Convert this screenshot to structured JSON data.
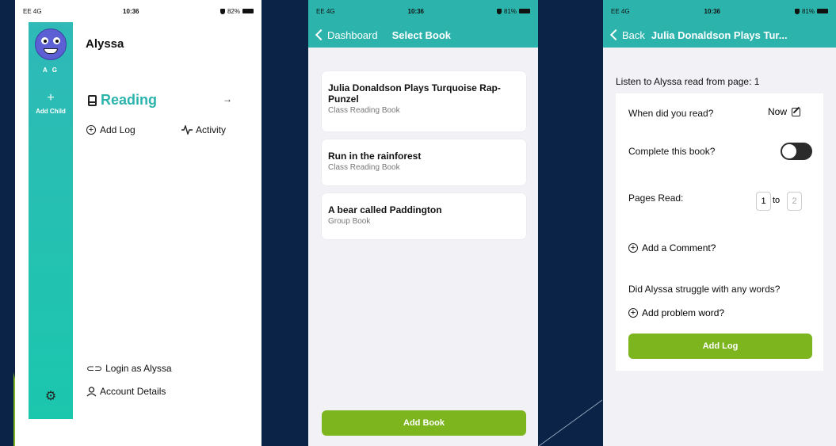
{
  "screen1": {
    "status": {
      "carrier": "EE 4G",
      "time": "10:36",
      "battery": "82%"
    },
    "rail": {
      "initials": "A G",
      "plus": "+",
      "add_child": "Add Child",
      "gear_icon": "gear-icon"
    },
    "child_name": "Alyssa",
    "reading_label": "Reading",
    "arrow": "→",
    "add_log": "Add Log",
    "activity": "Activity",
    "login_as": "Login as Alyssa",
    "account_details": "Account Details"
  },
  "screen2": {
    "status": {
      "carrier": "EE 4G",
      "time": "10:36",
      "battery": "81%"
    },
    "back": "Dashboard",
    "title": "Select Book",
    "books": [
      {
        "title": "Julia Donaldson Plays Turquoise Rap-Punzel",
        "type": "Class Reading Book"
      },
      {
        "title": "Run in the rainforest",
        "type": "Class Reading Book"
      },
      {
        "title": "A bear called Paddington",
        "type": "Group Book"
      }
    ],
    "add_book": "Add Book"
  },
  "screen3": {
    "status": {
      "carrier": "EE 4G",
      "time": "10:36",
      "battery": "81%"
    },
    "back": "Back",
    "title": "Julia Donaldson Plays Tur...",
    "listen": "Listen to Alyssa read from page: 1",
    "when_label": "When did you read?",
    "when_value": "Now",
    "complete_label": "Complete this book?",
    "complete_on": false,
    "pages_label": "Pages Read:",
    "page_from": "1",
    "to_label": "to",
    "page_to": "2",
    "add_comment": "Add a Comment?",
    "struggle": "Did Alyssa struggle with any words?",
    "add_problem_word": "Add problem word?",
    "add_log": "Add Log"
  },
  "colors": {
    "teal": "#2bb3ac",
    "green": "#7cb51e",
    "background": "#0b2347"
  }
}
